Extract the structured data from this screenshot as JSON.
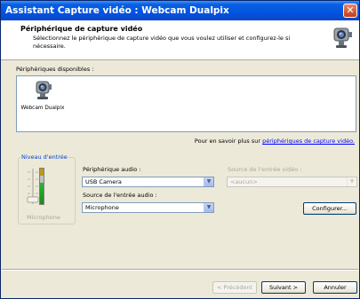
{
  "window": {
    "title": "Assistant Capture vidéo : Webcam Dualpix",
    "close_icon": "close-icon"
  },
  "header": {
    "title": "Périphérique de capture vidéo",
    "description": "Sélectionnez le périphérique de capture vidéo que vous voulez utiliser et configurez-le si nécessaire.",
    "icon": "webcam-icon"
  },
  "devices": {
    "label": "Périphériques disponibles :",
    "items": [
      {
        "label": "Webcam Dualpix",
        "icon": "webcam-icon"
      }
    ]
  },
  "more_info": {
    "prefix": "Pour en savoir plus sur ",
    "link": "périphériques de capture vidéo."
  },
  "input_level": {
    "title": "Niveau d'entrée",
    "caption": "Microphone",
    "level": 0.6
  },
  "audio": {
    "device_label": "Périphérique audio :",
    "device_value": "USB Camera",
    "source_label": "Source de l'entrée audio :",
    "source_value": "Microphone"
  },
  "video_source": {
    "label": "Source de l'entrée vidéo :",
    "value": "<aucun>"
  },
  "buttons": {
    "configure": "Configurer...",
    "back": "< Précédent",
    "next": "Suivant >",
    "cancel": "Annuler"
  },
  "colors": {
    "title_bar": "#0054e3",
    "dialog_bg": "#ece9d8",
    "link": "#0000ff",
    "group_title": "#0046d5",
    "meter_green": "#2fb52f"
  }
}
